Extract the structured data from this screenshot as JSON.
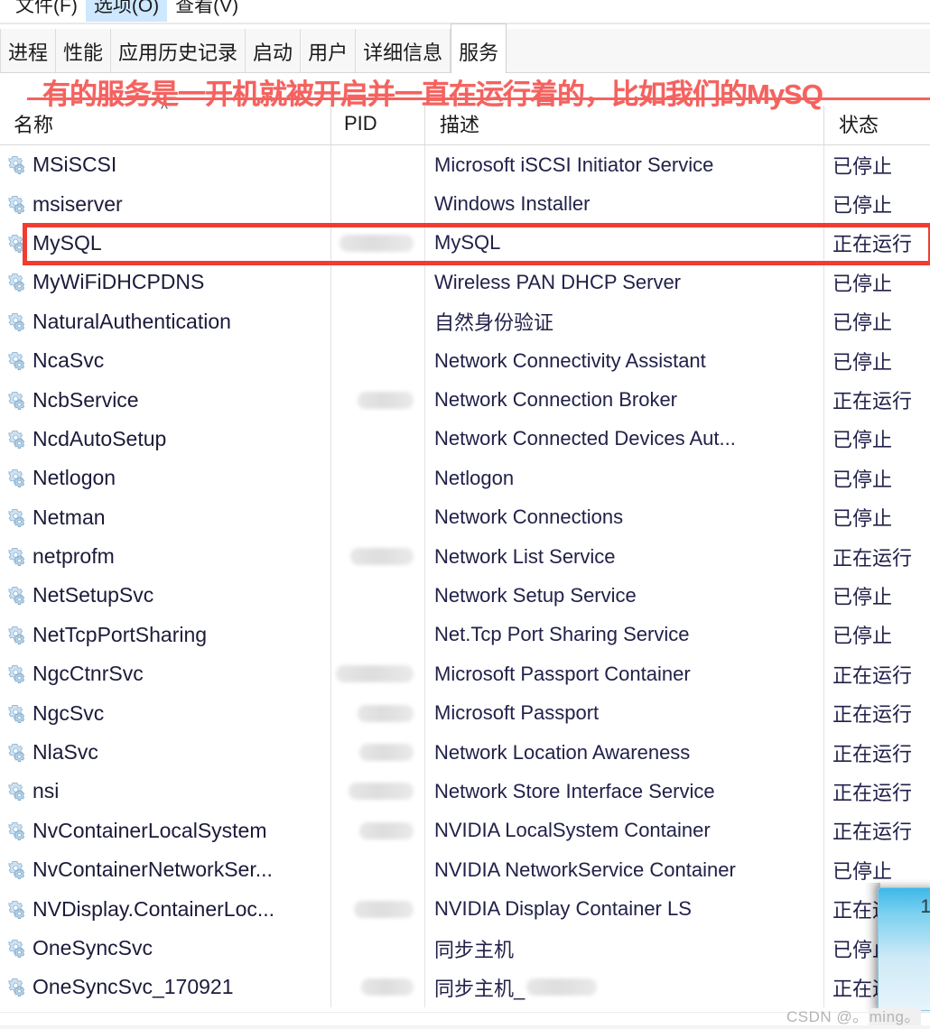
{
  "window": {
    "menu": [
      {
        "label": "文件(F)",
        "selected": false
      },
      {
        "label": "选项(O)",
        "selected": true
      },
      {
        "label": "查看(V)",
        "selected": false
      }
    ],
    "tabs": [
      {
        "label": "进程",
        "active": false
      },
      {
        "label": "性能",
        "active": false
      },
      {
        "label": "应用历史记录",
        "active": false
      },
      {
        "label": "启动",
        "active": false
      },
      {
        "label": "用户",
        "active": false
      },
      {
        "label": "详细信息",
        "active": false
      },
      {
        "label": "服务",
        "active": true
      }
    ]
  },
  "annotation": {
    "text": "有的服务是一开机就被开启并一直在运行着的，比如我们的MySQ",
    "color": "#f4625f"
  },
  "highlight": {
    "color": "#f03c32",
    "target_row": "MySQL"
  },
  "table": {
    "columns": [
      {
        "key": "name",
        "label": "名称"
      },
      {
        "key": "pid",
        "label": "PID"
      },
      {
        "key": "description",
        "label": "描述"
      },
      {
        "key": "status",
        "label": "状态"
      }
    ],
    "sort": {
      "column": "名称",
      "direction": "asc",
      "glyph": "^"
    },
    "status_values": {
      "running": "正在运行",
      "stopped": "已停止"
    },
    "rows": [
      {
        "name": "MSiSCSI",
        "pid": "",
        "pid_blur": 0,
        "description": "Microsoft iSCSI Initiator Service",
        "status": "已停止",
        "highlighted": false
      },
      {
        "name": "msiserver",
        "pid": "",
        "pid_blur": 0,
        "description": "Windows Installer",
        "status": "已停止",
        "highlighted": false
      },
      {
        "name": "MySQL",
        "pid": "••••",
        "pid_blur": 82,
        "description": "MySQL",
        "status": "正在运行",
        "highlighted": true
      },
      {
        "name": "MyWiFiDHCPDNS",
        "pid": "",
        "pid_blur": 0,
        "description": "Wireless PAN DHCP Server",
        "status": "已停止",
        "highlighted": false
      },
      {
        "name": "NaturalAuthentication",
        "pid": "",
        "pid_blur": 0,
        "description": "自然身份验证",
        "status": "已停止",
        "highlighted": false
      },
      {
        "name": "NcaSvc",
        "pid": "",
        "pid_blur": 0,
        "description": "Network Connectivity Assistant",
        "status": "已停止",
        "highlighted": false
      },
      {
        "name": "NcbService",
        "pid": "••••",
        "pid_blur": 62,
        "description": "Network Connection Broker",
        "status": "正在运行",
        "highlighted": false
      },
      {
        "name": "NcdAutoSetup",
        "pid": "",
        "pid_blur": 0,
        "description": "Network Connected Devices Aut...",
        "status": "已停止",
        "highlighted": false
      },
      {
        "name": "Netlogon",
        "pid": "",
        "pid_blur": 0,
        "description": "Netlogon",
        "status": "已停止",
        "highlighted": false
      },
      {
        "name": "Netman",
        "pid": "",
        "pid_blur": 0,
        "description": "Network Connections",
        "status": "已停止",
        "highlighted": false
      },
      {
        "name": "netprofm",
        "pid": "••••",
        "pid_blur": 70,
        "description": "Network List Service",
        "status": "正在运行",
        "highlighted": false
      },
      {
        "name": "NetSetupSvc",
        "pid": "",
        "pid_blur": 0,
        "description": "Network Setup Service",
        "status": "已停止",
        "highlighted": false
      },
      {
        "name": "NetTcpPortSharing",
        "pid": "",
        "pid_blur": 0,
        "description": "Net.Tcp Port Sharing Service",
        "status": "已停止",
        "highlighted": false
      },
      {
        "name": "NgcCtnrSvc",
        "pid": "••••",
        "pid_blur": 88,
        "description": "Microsoft Passport Container",
        "status": "正在运行",
        "highlighted": false
      },
      {
        "name": "NgcSvc",
        "pid": "••••",
        "pid_blur": 62,
        "description": "Microsoft Passport",
        "status": "正在运行",
        "highlighted": false
      },
      {
        "name": "NlaSvc",
        "pid": "••••",
        "pid_blur": 60,
        "description": "Network Location Awareness",
        "status": "正在运行",
        "highlighted": false
      },
      {
        "name": "nsi",
        "pid": "••••",
        "pid_blur": 72,
        "description": "Network Store Interface Service",
        "status": "正在运行",
        "highlighted": false
      },
      {
        "name": "NvContainerLocalSystem",
        "pid": "••••",
        "pid_blur": 60,
        "description": "NVIDIA LocalSystem Container",
        "status": "正在运行",
        "highlighted": false
      },
      {
        "name": "NvContainerNetworkSer...",
        "pid": "",
        "pid_blur": 0,
        "description": "NVIDIA NetworkService Container",
        "status": "已停止",
        "highlighted": false
      },
      {
        "name": "NVDisplay.ContainerLoc...",
        "pid": "••••",
        "pid_blur": 66,
        "description": "NVIDIA Display Container LS",
        "status": "正在运行",
        "highlighted": false
      },
      {
        "name": "OneSyncSvc",
        "pid": "",
        "pid_blur": 0,
        "description": "同步主机",
        "status": "已停止",
        "highlighted": false
      },
      {
        "name": "OneSyncSvc_170921",
        "pid": "••••",
        "pid_blur": 58,
        "description": "同步主机_",
        "status": "正在运行",
        "highlighted": false
      }
    ]
  },
  "popup": {
    "number": "1"
  },
  "watermark": {
    "prefix": "CSDN @。",
    "name": "ming。"
  }
}
